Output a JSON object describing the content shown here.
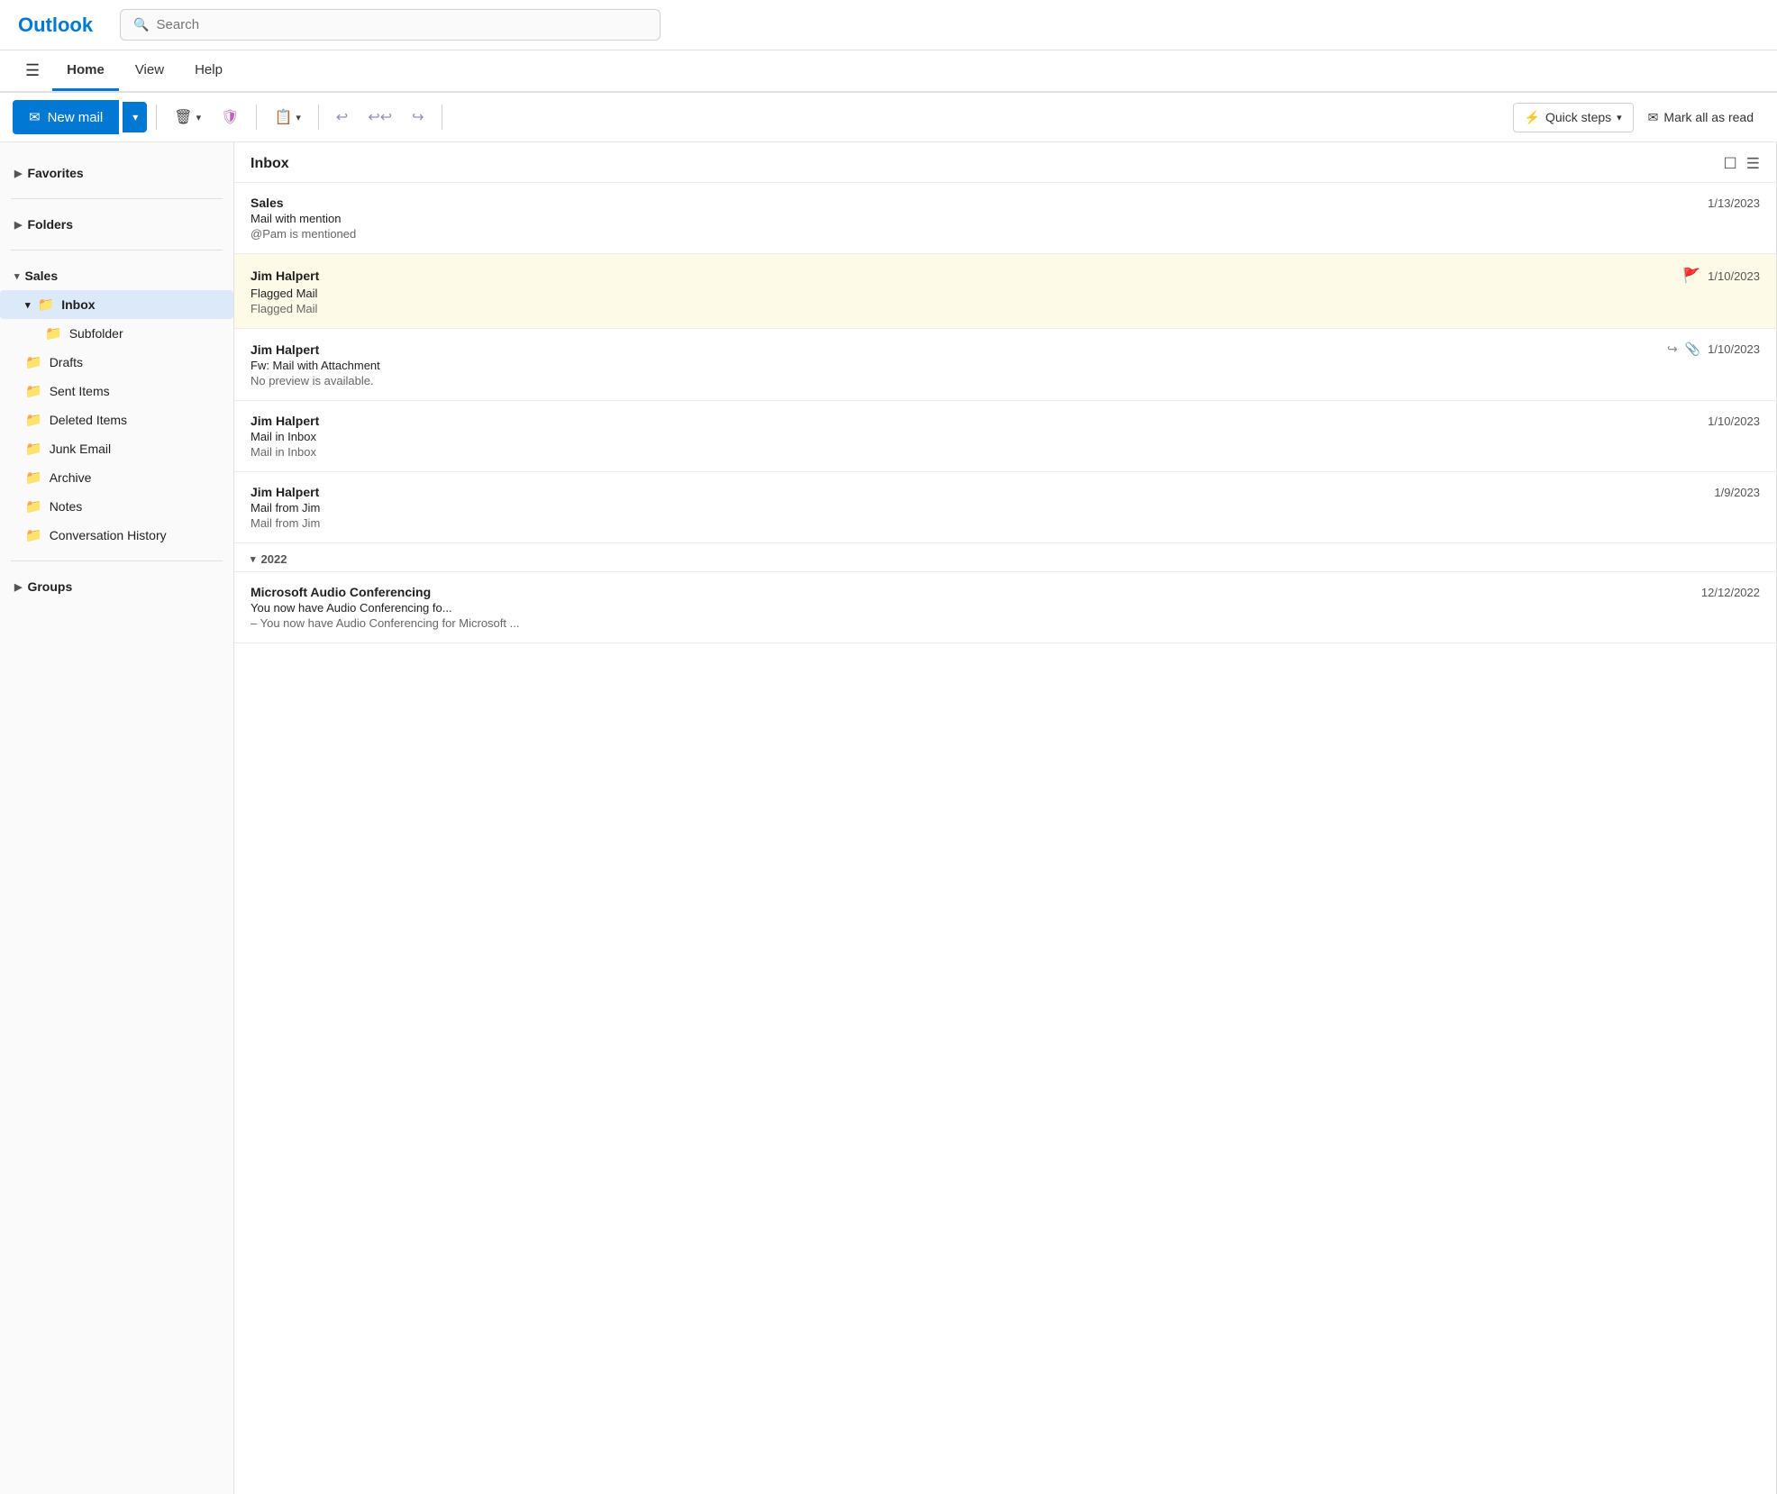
{
  "app": {
    "title": "Outlook"
  },
  "search": {
    "placeholder": "Search"
  },
  "header_tabs": [
    {
      "id": "home",
      "label": "Home",
      "active": true
    },
    {
      "id": "view",
      "label": "View",
      "active": false
    },
    {
      "id": "help",
      "label": "Help",
      "active": false
    }
  ],
  "toolbar": {
    "new_mail": "New mail",
    "new_mail_dropdown": "▾",
    "delete_icon": "🗑",
    "shield_icon": "🛡",
    "move_icon": "📋",
    "reply_icon": "↩",
    "reply_all_icon": "↩↩",
    "forward_icon": "↪",
    "quick_steps_icon": "⚡",
    "quick_steps_label": "Quick steps",
    "quick_steps_dropdown": "▾",
    "mark_all_icon": "✉",
    "mark_all_label": "Mark all as read"
  },
  "sidebar": {
    "favorites": "Favorites",
    "folders": "Folders",
    "sales": "Sales",
    "inbox": "Inbox",
    "subfolder": "Subfolder",
    "drafts": "Drafts",
    "sent_items": "Sent Items",
    "deleted_items": "Deleted Items",
    "junk_email": "Junk Email",
    "archive": "Archive",
    "notes": "Notes",
    "conversation_history": "Conversation History",
    "groups": "Groups"
  },
  "inbox": {
    "title": "Inbox",
    "emails": [
      {
        "id": 1,
        "sender": "Sales",
        "subject": "Mail with mention",
        "preview": "@Pam is mentioned",
        "date": "1/13/2023",
        "flagged": false,
        "highlighted": false,
        "forwarded": false,
        "has_attachment": false
      },
      {
        "id": 2,
        "sender": "Jim Halpert",
        "subject": "Flagged Mail",
        "preview": "Flagged Mail",
        "date": "1/10/2023",
        "flagged": true,
        "highlighted": true,
        "forwarded": false,
        "has_attachment": false
      },
      {
        "id": 3,
        "sender": "Jim Halpert",
        "subject": "Fw: Mail with Attachment",
        "preview": "No preview is available.",
        "date": "1/10/2023",
        "flagged": false,
        "highlighted": false,
        "forwarded": true,
        "has_attachment": true
      },
      {
        "id": 4,
        "sender": "Jim Halpert",
        "subject": "Mail in Inbox",
        "preview": "Mail in Inbox",
        "date": "1/10/2023",
        "flagged": false,
        "highlighted": false,
        "forwarded": false,
        "has_attachment": false
      },
      {
        "id": 5,
        "sender": "Jim Halpert",
        "subject": "Mail from Jim",
        "preview": "Mail from Jim",
        "date": "1/9/2023",
        "flagged": false,
        "highlighted": false,
        "forwarded": false,
        "has_attachment": false
      }
    ],
    "group_2022": "2022",
    "email_2022": {
      "sender": "Microsoft Audio Conferencing",
      "subject": "You now have Audio Conferencing fo...",
      "preview": "– You now have Audio Conferencing for Microsoft ...",
      "date": "12/12/2022"
    }
  }
}
